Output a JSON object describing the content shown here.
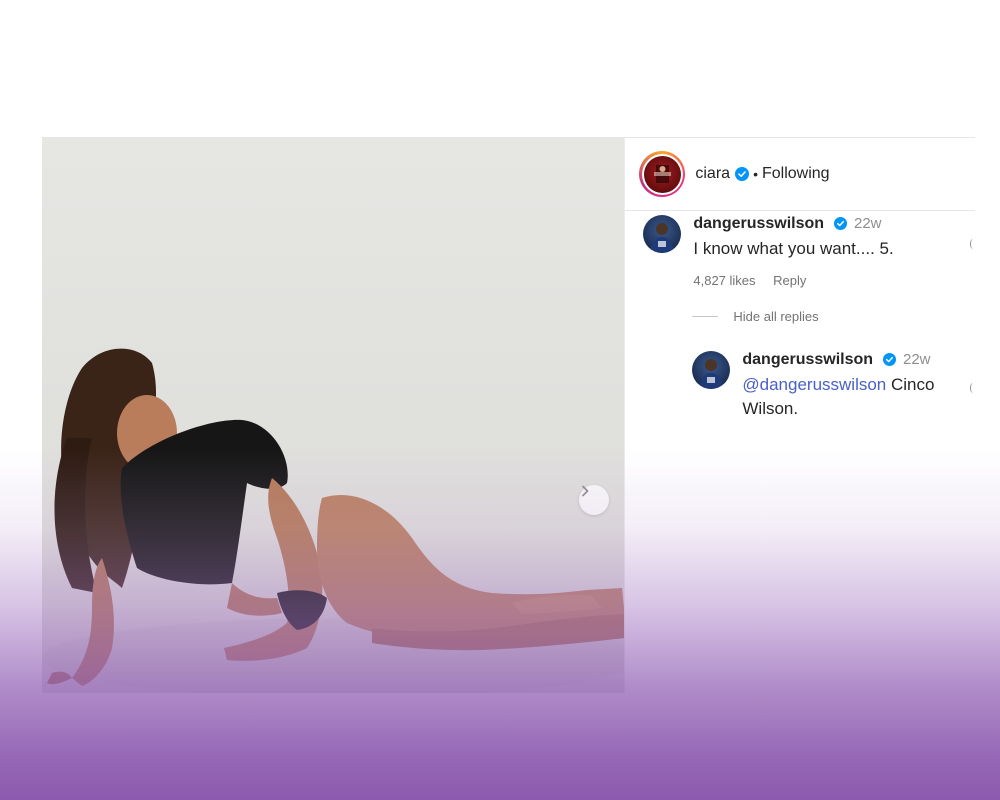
{
  "post": {
    "username": "ciara",
    "follow_status": "Following",
    "separator": "•"
  },
  "comments": [
    {
      "username": "dangerusswilson",
      "time": "22w",
      "text": "I know what you want.... 5.",
      "likes": "4,827 likes",
      "reply_label": "Reply"
    }
  ],
  "hide_replies_label": "Hide all replies",
  "replies": [
    {
      "username": "dangerusswilson",
      "time": "22w",
      "mention": "@dangerusswilson",
      "text": " Cinco Wilson."
    }
  ],
  "icons": {
    "verified": "verified-badge-icon",
    "next": "chevron-right-icon",
    "like": "heart-icon"
  },
  "colors": {
    "verified_blue": "#0095f6",
    "mention": "#4a60c8",
    "fade_purple": "#8c5aaf"
  }
}
